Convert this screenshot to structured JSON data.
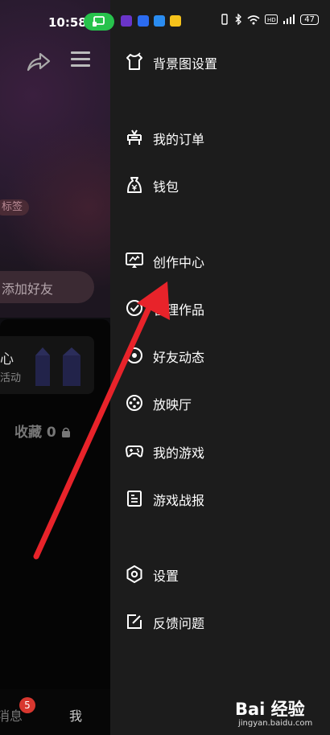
{
  "status_bar": {
    "time": "10:58",
    "battery": "47"
  },
  "left_panel": {
    "tag_text": "标签",
    "add_friend": "添加好友",
    "card_title": "心",
    "card_sub": "活动",
    "favorites": "收藏 0",
    "tabs": {
      "messages": "消息",
      "messages_badge": "5",
      "me": "我"
    }
  },
  "drawer": {
    "items": [
      {
        "label": "背景图设置",
        "icon": "tshirt-icon"
      },
      {
        "label": "我的订单",
        "icon": "order-icon"
      },
      {
        "label": "钱包",
        "icon": "wallet-icon"
      },
      {
        "label": "创作中心",
        "icon": "creator-icon"
      },
      {
        "label": "管理作品",
        "icon": "check-circle-icon"
      },
      {
        "label": "好友动态",
        "icon": "friends-feed-icon"
      },
      {
        "label": "放映厅",
        "icon": "film-reel-icon"
      },
      {
        "label": "我的游戏",
        "icon": "gamepad-icon"
      },
      {
        "label": "游戏战报",
        "icon": "report-icon"
      },
      {
        "label": "设置",
        "icon": "settings-icon"
      },
      {
        "label": "反馈问题",
        "icon": "feedback-icon"
      }
    ]
  },
  "watermark": {
    "brand": "Bai 经验",
    "url": "jingyan.baidu.com"
  },
  "colors": {
    "drawer_bg": "#1c1c1c",
    "annotation_arrow": "#e8232a",
    "status_cast": "#27c24c"
  }
}
